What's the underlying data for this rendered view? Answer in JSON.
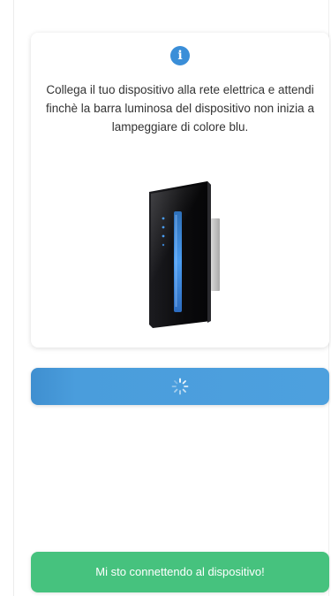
{
  "card": {
    "icon": "info-icon",
    "icon_glyph": "i",
    "instructions": "Collega il tuo dispositivo alla rete elettrica e attendi finchè la barra luminosa del dispositivo non inizia a lampeggiare di colore blu.",
    "image": "device-image"
  },
  "loading": {
    "icon": "spinner-icon"
  },
  "status_button": {
    "label": "Mi sto connettendo al dispositivo!"
  },
  "colors": {
    "accent_blue": "#4da0de",
    "info_icon": "#3a8ed8",
    "success_green": "#46c27e",
    "device_light": "#3f8fe8"
  }
}
